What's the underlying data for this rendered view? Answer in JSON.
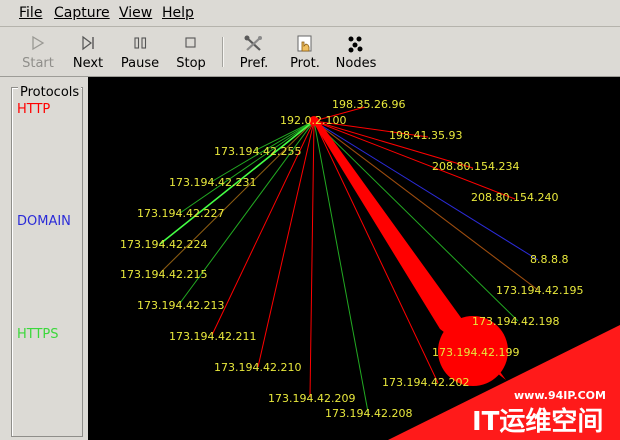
{
  "menu": [
    "File",
    "Capture",
    "View",
    "Help"
  ],
  "toolbar": {
    "start": "Start",
    "next": "Next",
    "pause": "Pause",
    "stop": "Stop",
    "pref": "Pref.",
    "prot": "Prot.",
    "nodes": "Nodes"
  },
  "protocols": {
    "title": "Protocols",
    "http": {
      "label": "HTTP",
      "color": "#ff0000"
    },
    "domain": {
      "label": "DOMAIN",
      "color": "#2b2bd8"
    },
    "https": {
      "label": "HTTPS",
      "color": "#3cd83c"
    }
  },
  "graph": {
    "source_node": "192.0.2.100",
    "nodes": [
      "198.35.26.96",
      "198.41.35.93",
      "208.80.154.234",
      "208.80.154.240",
      "8.8.8.8",
      "173.194.42.195",
      "173.194.42.198",
      "173.194.42.199",
      "173.194.42.202",
      "173.194.42.208",
      "173.194.42.209",
      "173.194.42.210",
      "173.194.42.211",
      "173.194.42.213",
      "173.194.42.215",
      "173.194.42.224",
      "173.194.42.227",
      "173.194.42.231",
      "173.194.42.255"
    ]
  },
  "watermark": {
    "url": "www.94IP.COM",
    "brand": "IT运维空间"
  }
}
